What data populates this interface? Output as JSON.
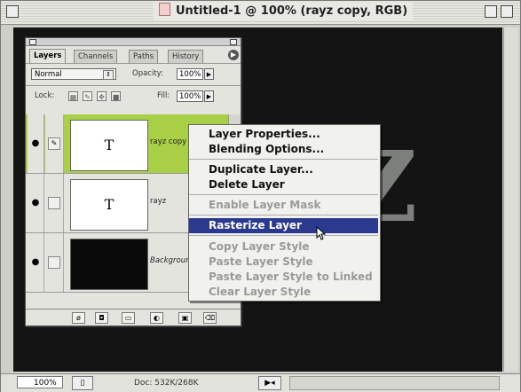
{
  "window": {
    "title": "Untitled-1 @ 100% (rayz copy, RGB)"
  },
  "canvas": {
    "big_letter": "Z"
  },
  "status": {
    "zoom": "100%",
    "doc": "Doc: 532K/268K"
  },
  "palette": {
    "tabs": [
      "Layers",
      "Channels",
      "Paths",
      "History"
    ],
    "blend_mode": "Normal",
    "opacity_label": "Opacity:",
    "opacity_value": "100%",
    "lock_label": "Lock:",
    "fill_label": "Fill:",
    "fill_value": "100%",
    "layers": [
      {
        "name": "rayz copy",
        "thumb": "T"
      },
      {
        "name": "rayz",
        "thumb": "T"
      },
      {
        "name": "Background",
        "thumb": ""
      }
    ]
  },
  "menu": {
    "items": [
      "Layer Properties...",
      "Blending Options...",
      "Duplicate Layer...",
      "Delete Layer",
      "Enable Layer Mask",
      "Rasterize Layer",
      "Copy Layer Style",
      "Paste Layer Style",
      "Paste Layer Style to Linked",
      "Clear Layer Style"
    ],
    "highlighted": "Rasterize Layer"
  },
  "colors": {
    "selected_layer": "#a9cf47",
    "menu_highlight": "#2b3a8f"
  }
}
